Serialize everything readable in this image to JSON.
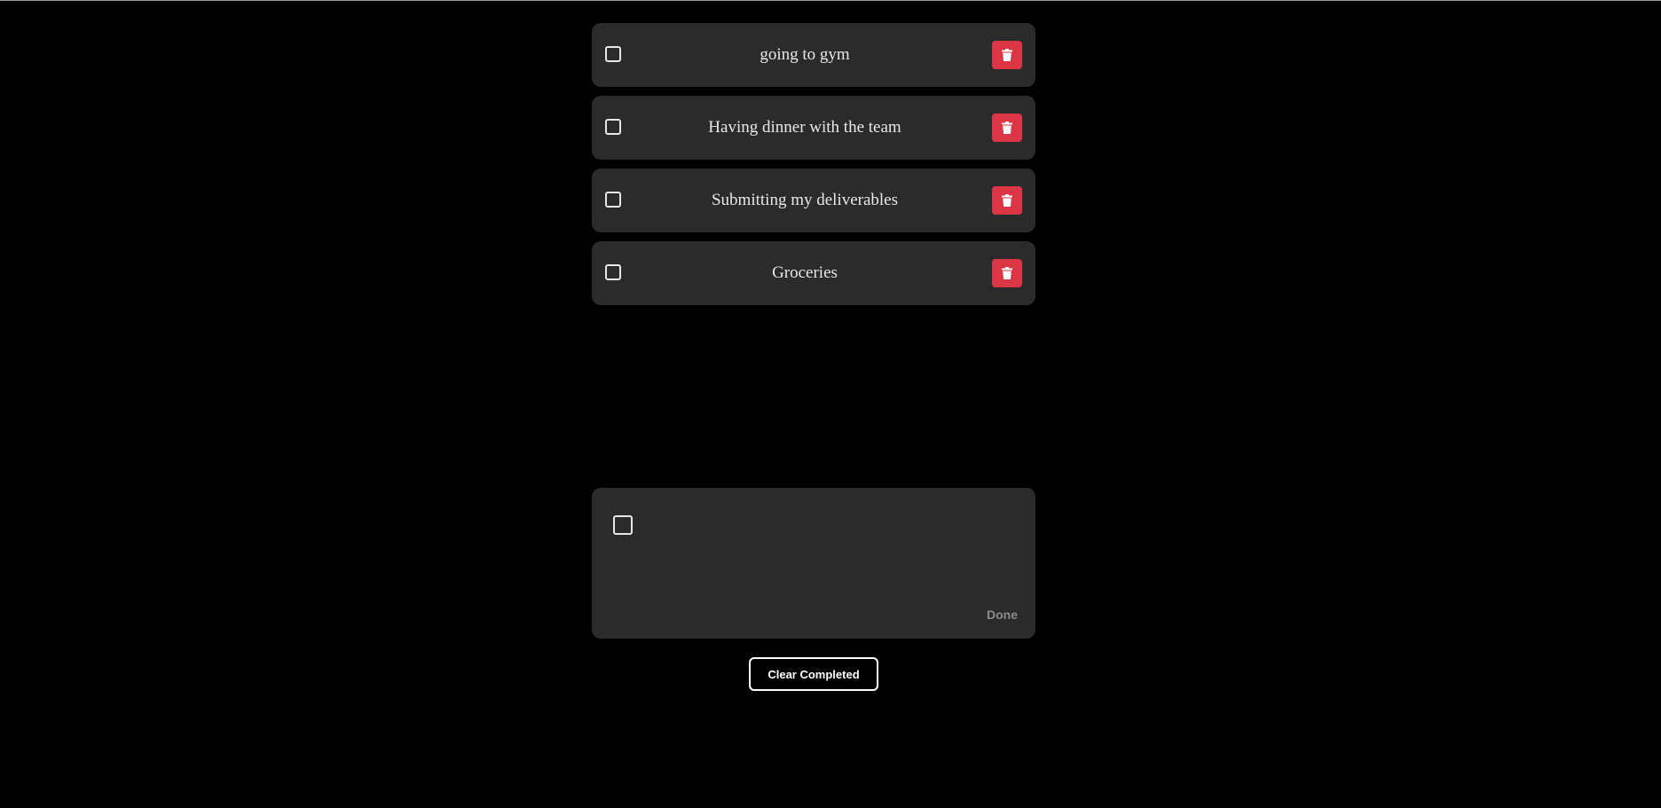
{
  "todos": [
    {
      "text": "going to gym",
      "completed": false
    },
    {
      "text": "Having dinner with the team",
      "completed": false
    },
    {
      "text": "Submitting my deliverables",
      "completed": false
    },
    {
      "text": "Groceries",
      "completed": false
    }
  ],
  "composer": {
    "text_value": "",
    "done_label": "Done"
  },
  "actions": {
    "clear_completed_label": "Clear Completed"
  },
  "icons": {
    "checkbox": "checkbox-icon",
    "delete": "trash-icon"
  },
  "colors": {
    "background": "#000000",
    "card": "#2b2b2b",
    "delete_accent": "#dc3545",
    "text": "#e8e8e8",
    "done_muted": "#8a8a8a"
  }
}
